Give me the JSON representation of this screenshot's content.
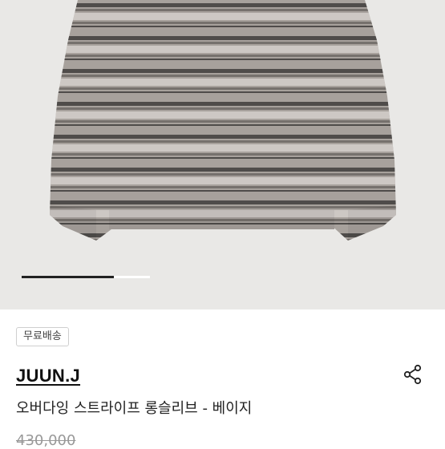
{
  "product_image": {
    "description_icon": "striped-long-sleeve-shirt",
    "slide_progress": 0.72
  },
  "badge": {
    "label": "무료배송"
  },
  "brand": {
    "name": "JUUN.J"
  },
  "product": {
    "title": "오버다잉 스트라이프 롱슬리브 - 베이지",
    "original_price": "430,000"
  },
  "colors": {
    "image_background": "#e9e8e6",
    "shirt_base": "#a7a19c",
    "stripe_dark": "#3f3d3c",
    "stripe_mid": "#6d6865",
    "stripe_light": "#d3cfcb"
  },
  "icons": {
    "share": "share-icon"
  }
}
